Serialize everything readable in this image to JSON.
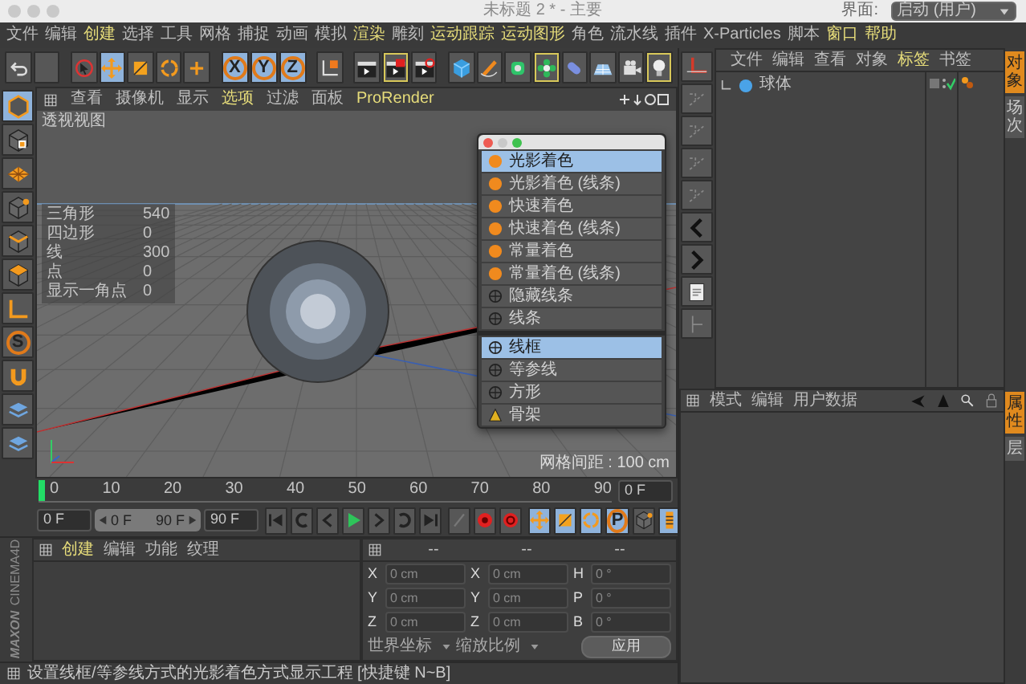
{
  "window": {
    "title": "未标题 2 * - 主要"
  },
  "menu": [
    {
      "label": "文件",
      "highlight": false
    },
    {
      "label": "编辑",
      "highlight": false
    },
    {
      "label": "创建",
      "highlight": true
    },
    {
      "label": "选择",
      "highlight": false
    },
    {
      "label": "工具",
      "highlight": false
    },
    {
      "label": "网格",
      "highlight": false
    },
    {
      "label": "捕捉",
      "highlight": false
    },
    {
      "label": "动画",
      "highlight": false
    },
    {
      "label": "模拟",
      "highlight": false
    },
    {
      "label": "渲染",
      "highlight": true
    },
    {
      "label": "雕刻",
      "highlight": false
    },
    {
      "label": "运动跟踪",
      "highlight": true
    },
    {
      "label": "运动图形",
      "highlight": true
    },
    {
      "label": "角色",
      "highlight": false
    },
    {
      "label": "流水线",
      "highlight": false
    },
    {
      "label": "插件",
      "highlight": false
    },
    {
      "label": "X-Particles",
      "highlight": false
    },
    {
      "label": "脚本",
      "highlight": false
    },
    {
      "label": "窗口",
      "highlight": true
    },
    {
      "label": "帮助",
      "highlight": true
    }
  ],
  "layout": {
    "label": "界面:",
    "value": "启动 (用户)"
  },
  "toolbar": [
    {
      "kind": "undo",
      "selected": false,
      "outlined": false
    },
    {
      "kind": "blank",
      "selected": false,
      "outlined": false
    },
    {
      "kind": "select",
      "selected": false,
      "outlined": false
    },
    {
      "kind": "move",
      "selected": true,
      "outlined": false
    },
    {
      "kind": "scale",
      "selected": false,
      "outlined": false
    },
    {
      "kind": "rotate",
      "selected": false,
      "outlined": false
    },
    {
      "kind": "transform",
      "selected": false,
      "outlined": false
    },
    {
      "kind": "axis",
      "label": "X",
      "selected": true,
      "outlined": false
    },
    {
      "kind": "axis",
      "label": "Y",
      "selected": true,
      "outlined": false
    },
    {
      "kind": "axis",
      "label": "Z",
      "selected": true,
      "outlined": false
    },
    {
      "kind": "coord",
      "selected": false,
      "outlined": false
    },
    {
      "kind": "renderview",
      "selected": false,
      "outlined": false
    },
    {
      "kind": "renderpicture",
      "selected": false,
      "outlined": true
    },
    {
      "kind": "rendersettings",
      "selected": false,
      "outlined": false
    },
    {
      "kind": "cube",
      "selected": false,
      "outlined": false
    },
    {
      "kind": "pen",
      "selected": false,
      "outlined": false
    },
    {
      "kind": "subdivision",
      "selected": false,
      "outlined": false
    },
    {
      "kind": "cloner",
      "selected": false,
      "outlined": true
    },
    {
      "kind": "deformer",
      "selected": false,
      "outlined": false
    },
    {
      "kind": "floor",
      "selected": false,
      "outlined": false
    },
    {
      "kind": "camera",
      "selected": false,
      "outlined": false
    },
    {
      "kind": "light",
      "selected": false,
      "outlined": true
    }
  ],
  "left_tools": [
    {
      "kind": "model",
      "selected": true
    },
    {
      "kind": "texture",
      "selected": false
    },
    {
      "kind": "workplane",
      "selected": false
    },
    {
      "kind": "points",
      "selected": false
    },
    {
      "kind": "edges",
      "selected": false
    },
    {
      "kind": "polygons",
      "selected": false
    },
    {
      "kind": "axis",
      "selected": false
    },
    {
      "kind": "snap",
      "label": "S",
      "selected": false
    },
    {
      "kind": "magnet",
      "selected": false
    },
    {
      "kind": "layers",
      "selected": false
    },
    {
      "kind": "layers",
      "selected": false
    }
  ],
  "viewport": {
    "menu": [
      {
        "label": "查看",
        "highlight": false
      },
      {
        "label": "摄像机",
        "highlight": false
      },
      {
        "label": "显示",
        "highlight": false
      },
      {
        "label": "选项",
        "highlight": true
      },
      {
        "label": "过滤",
        "highlight": false
      },
      {
        "label": "面板",
        "highlight": false
      },
      {
        "label": "ProRender",
        "highlight": true
      }
    ],
    "label": "透视视图",
    "stats": [
      {
        "label": "三角形",
        "value": "540"
      },
      {
        "label": "四边形",
        "value": "0"
      },
      {
        "label": "线",
        "value": "300"
      },
      {
        "label": "点",
        "value": "0"
      },
      {
        "label": "显示一角点",
        "value": "0"
      }
    ],
    "grid_spacing": "网格间距 : 100 cm",
    "display_menu": [
      {
        "kind": "shade",
        "label": "光影着色",
        "selected": true
      },
      {
        "kind": "shade",
        "label": "光影着色 (线条)",
        "selected": false
      },
      {
        "kind": "shade",
        "label": "快速着色",
        "selected": false
      },
      {
        "kind": "shade",
        "label": "快速着色 (线条)",
        "selected": false
      },
      {
        "kind": "shade",
        "label": "常量着色",
        "selected": false
      },
      {
        "kind": "shade",
        "label": "常量着色 (线条)",
        "selected": false
      },
      {
        "kind": "line",
        "label": "隐藏线条",
        "selected": false
      },
      {
        "kind": "line",
        "label": "线条",
        "selected": false
      },
      {
        "kind": "separator"
      },
      {
        "kind": "line",
        "label": "线框",
        "selected": true
      },
      {
        "kind": "line",
        "label": "等参线",
        "selected": false
      },
      {
        "kind": "line",
        "label": "方形",
        "selected": false
      },
      {
        "kind": "skeleton",
        "label": "骨架",
        "selected": false
      }
    ]
  },
  "timeline": {
    "ticks": [
      "0",
      "10",
      "20",
      "30",
      "40",
      "50",
      "60",
      "70",
      "80",
      "90"
    ],
    "current": "0 F",
    "start": "0 F",
    "range": {
      "start": "0 F",
      "end": "90 F",
      "level": 1
    },
    "end": "90 F",
    "controls": [
      {
        "kind": "tostart",
        "selected": false
      },
      {
        "kind": "prevkey",
        "selected": false
      },
      {
        "kind": "prevframe",
        "selected": false
      },
      {
        "kind": "play",
        "selected": false
      },
      {
        "kind": "nextframe",
        "selected": false
      },
      {
        "kind": "nextkey",
        "selected": false
      },
      {
        "kind": "toend",
        "selected": false
      },
      {
        "kind": "recordoff",
        "selected": false
      },
      {
        "kind": "record",
        "selected": false
      },
      {
        "kind": "autokey",
        "selected": false
      },
      {
        "kind": "move",
        "selected": true
      },
      {
        "kind": "scale",
        "selected": true
      },
      {
        "kind": "rotate",
        "selected": true
      },
      {
        "kind": "param",
        "label": "P",
        "selected": true
      },
      {
        "kind": "points",
        "selected": false
      },
      {
        "kind": "timeline",
        "selected": true
      }
    ]
  },
  "materials": {
    "menu": [
      {
        "label": "创建",
        "highlight": true
      },
      {
        "label": "编辑",
        "highlight": false
      },
      {
        "label": "功能",
        "highlight": false
      },
      {
        "label": "纹理",
        "highlight": false
      }
    ]
  },
  "coordinates": {
    "headers": [
      "--",
      "--",
      "--"
    ],
    "rows": [
      {
        "cells": [
          {
            "axis": "X",
            "value": "0 cm"
          },
          {
            "axis": "X",
            "value": "0 cm"
          },
          {
            "axis": "H",
            "value": "0 °"
          }
        ]
      },
      {
        "cells": [
          {
            "axis": "Y",
            "value": "0 cm"
          },
          {
            "axis": "Y",
            "value": "0 cm"
          },
          {
            "axis": "P",
            "value": "0 °"
          }
        ]
      },
      {
        "cells": [
          {
            "axis": "Z",
            "value": "0 cm"
          },
          {
            "axis": "Z",
            "value": "0 cm"
          },
          {
            "axis": "B",
            "value": "0 °"
          }
        ]
      }
    ],
    "mode": "世界坐标",
    "scale_mode": "缩放比例",
    "apply": "应用"
  },
  "status_bar": "设置线框/等参线方式的光影着色方式显示工程 [快捷键 N~B]",
  "logo": {
    "brand": "MAXON",
    "product": "CINEMA4D"
  },
  "objects": {
    "menu": [
      {
        "label": "文件",
        "highlight": false
      },
      {
        "label": "编辑",
        "highlight": false
      },
      {
        "label": "查看",
        "highlight": false
      },
      {
        "label": "对象",
        "highlight": false
      },
      {
        "label": "标签",
        "highlight": true
      },
      {
        "label": "书签",
        "highlight": false
      }
    ],
    "items": [
      {
        "name": "球体"
      }
    ],
    "side_tabs": [
      {
        "label": "对象",
        "selected": true
      },
      {
        "label": "场次",
        "selected": false
      }
    ]
  },
  "attributes": {
    "menu": [
      {
        "label": "模式",
        "highlight": false
      },
      {
        "label": "编辑",
        "highlight": false
      },
      {
        "label": "用户数据",
        "highlight": false
      }
    ],
    "side_tabs": [
      {
        "label": "属性",
        "selected": true
      },
      {
        "label": "层",
        "selected": false
      }
    ]
  }
}
